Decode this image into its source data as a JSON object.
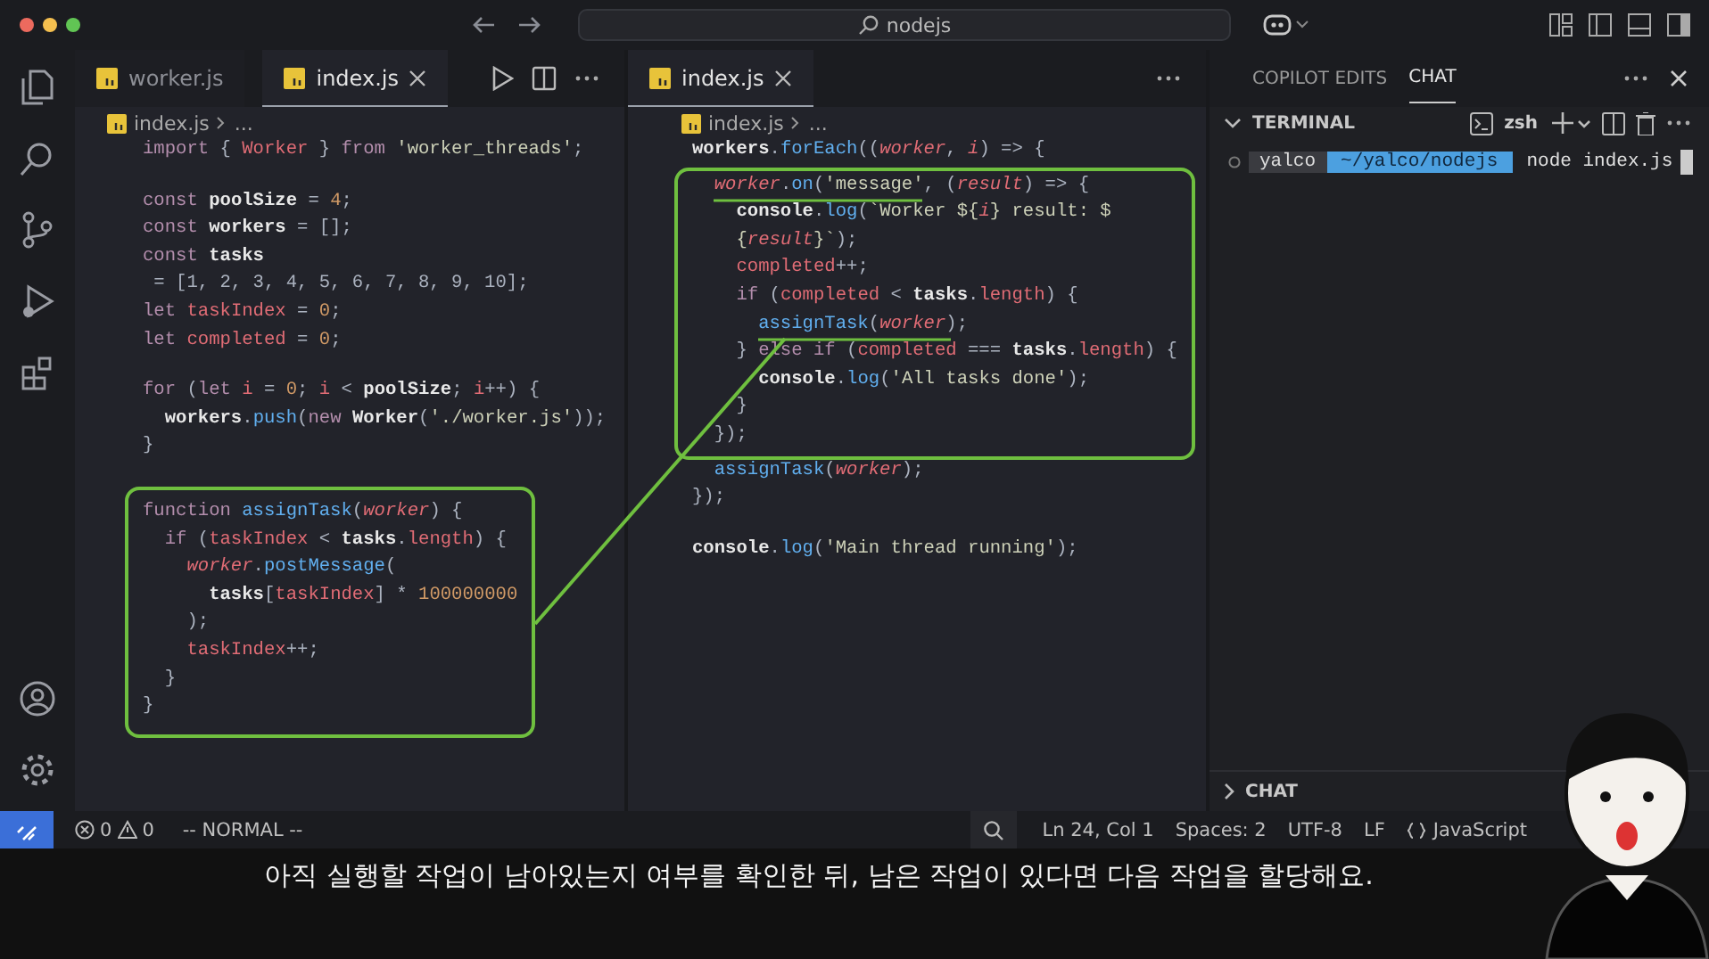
{
  "title_bar": {
    "search": "nodejs"
  },
  "editors": [
    {
      "tabs": [
        {
          "label": "worker.js",
          "selected": false
        },
        {
          "label": "index.js",
          "selected": true
        }
      ],
      "actions": true,
      "breadcrumb": {
        "file": "index.js",
        "rest": "..."
      },
      "paragraphs": [
        [
          {
            "boxed": false,
            "lines": [
              [
                {
                  "kind": "keyword",
                  "text": "import"
                },
                {
                  "kind": "plain",
                  "text": " { "
                },
                {
                  "kind": "variable",
                  "text": "Worker"
                },
                {
                  "kind": "plain",
                  "text": " } "
                },
                {
                  "kind": "keyword",
                  "text": "from"
                },
                {
                  "kind": "string",
                  "text": " 'worker_threads'"
                },
                {
                  "kind": "plain",
                  "text": ";"
                }
              ]
            ]
          }
        ],
        [
          {
            "boxed": false,
            "lines": [
              [
                {
                  "kind": "keyword",
                  "text": "const"
                },
                {
                  "kind": "constant",
                  "text": " poolSize"
                },
                {
                  "kind": "plain",
                  "text": " = "
                },
                {
                  "kind": "number",
                  "text": "4"
                },
                {
                  "kind": "plain",
                  "text": ";"
                }
              ],
              [
                {
                  "kind": "keyword",
                  "text": "const"
                },
                {
                  "kind": "constant",
                  "text": " workers"
                },
                {
                  "kind": "plain",
                  "text": " = [];"
                }
              ],
              [
                {
                  "kind": "keyword",
                  "text": "const"
                },
                {
                  "kind": "constant",
                  "text": " tasks"
                }
              ],
              [
                {
                  "kind": "plain",
                  "text": " = [1, 2, 3, 4, 5, 6, 7, 8, 9, 10];"
                }
              ],
              [
                {
                  "kind": "keyword",
                  "text": "let"
                },
                {
                  "kind": "variable",
                  "text": " taskIndex"
                },
                {
                  "kind": "plain",
                  "text": " = "
                },
                {
                  "kind": "number",
                  "text": "0"
                },
                {
                  "kind": "plain",
                  "text": ";"
                }
              ],
              [
                {
                  "kind": "keyword",
                  "text": "let"
                },
                {
                  "kind": "variable",
                  "text": " completed"
                },
                {
                  "kind": "plain",
                  "text": " = "
                },
                {
                  "kind": "number",
                  "text": "0"
                },
                {
                  "kind": "plain",
                  "text": ";"
                }
              ]
            ]
          }
        ],
        [
          {
            "boxed": false,
            "lines": [
              [
                {
                  "kind": "keyword",
                  "text": "for"
                },
                {
                  "kind": "plain",
                  "text": " ("
                },
                {
                  "kind": "keyword",
                  "text": "let"
                },
                {
                  "kind": "variable",
                  "text": " i"
                },
                {
                  "kind": "plain",
                  "text": " = "
                },
                {
                  "kind": "number",
                  "text": "0"
                },
                {
                  "kind": "plain",
                  "text": "; "
                },
                {
                  "kind": "variable",
                  "text": "i"
                },
                {
                  "kind": "plain",
                  "text": " < "
                },
                {
                  "kind": "constant",
                  "text": "poolSize"
                },
                {
                  "kind": "plain",
                  "text": "; "
                },
                {
                  "kind": "variable",
                  "text": "i"
                },
                {
                  "kind": "plain",
                  "text": "++) {"
                }
              ],
              [
                {
                  "kind": "constant",
                  "text": "  workers"
                },
                {
                  "kind": "plain",
                  "text": "."
                },
                {
                  "kind": "function",
                  "text": "push"
                },
                {
                  "kind": "plain",
                  "text": "("
                },
                {
                  "kind": "keyword",
                  "text": "new"
                },
                {
                  "kind": "constant",
                  "text": " Worker"
                },
                {
                  "kind": "plain",
                  "text": "("
                },
                {
                  "kind": "string",
                  "text": "'./worker.js'"
                },
                {
                  "kind": "plain",
                  "text": "));"
                }
              ],
              [
                {
                  "kind": "plain",
                  "text": "}"
                }
              ]
            ]
          }
        ],
        [
          {
            "boxed": true,
            "lines": [
              [
                {
                  "kind": "keyword",
                  "text": "function"
                },
                {
                  "kind": "function",
                  "text": " assignTask"
                },
                {
                  "kind": "plain",
                  "text": "("
                },
                {
                  "kind": "param",
                  "text": "worker"
                },
                {
                  "kind": "plain",
                  "text": ") {"
                }
              ],
              [
                {
                  "kind": "keyword",
                  "text": "  if"
                },
                {
                  "kind": "plain",
                  "text": " ("
                },
                {
                  "kind": "variable",
                  "text": "taskIndex"
                },
                {
                  "kind": "plain",
                  "text": " < "
                },
                {
                  "kind": "constant",
                  "text": "tasks"
                },
                {
                  "kind": "plain",
                  "text": "."
                },
                {
                  "kind": "variable",
                  "text": "length"
                },
                {
                  "kind": "plain",
                  "text": ") {"
                }
              ],
              [
                {
                  "kind": "param",
                  "text": "    worker"
                },
                {
                  "kind": "plain",
                  "text": "."
                },
                {
                  "kind": "function",
                  "text": "postMessage"
                },
                {
                  "kind": "plain",
                  "text": "("
                }
              ],
              [
                {
                  "kind": "constant",
                  "text": "      tasks"
                },
                {
                  "kind": "plain",
                  "text": "["
                },
                {
                  "kind": "variable",
                  "text": "taskIndex"
                },
                {
                  "kind": "plain",
                  "text": "] * "
                },
                {
                  "kind": "number",
                  "text": "100000000"
                }
              ],
              [
                {
                  "kind": "plain",
                  "text": "    );"
                }
              ],
              [
                {
                  "kind": "variable",
                  "text": "    taskIndex"
                },
                {
                  "kind": "plain",
                  "text": "++;"
                }
              ],
              [
                {
                  "kind": "plain",
                  "text": "  }"
                }
              ],
              [
                {
                  "kind": "plain",
                  "text": "}"
                }
              ]
            ]
          }
        ]
      ]
    },
    {
      "tabs": [
        {
          "label": "index.js",
          "selected": true
        }
      ],
      "actions": false,
      "breadcrumb": {
        "file": "index.js",
        "rest": "..."
      },
      "paragraphs": [
        [
          {
            "boxed": false,
            "lines": [
              [
                {
                  "kind": "constant",
                  "text": "workers"
                },
                {
                  "kind": "plain",
                  "text": "."
                },
                {
                  "kind": "function",
                  "text": "forEach"
                },
                {
                  "kind": "plain",
                  "text": "(("
                },
                {
                  "kind": "param",
                  "text": "worker"
                },
                {
                  "kind": "plain",
                  "text": ", "
                },
                {
                  "kind": "param",
                  "text": "i"
                },
                {
                  "kind": "plain",
                  "text": ") => {"
                }
              ]
            ]
          },
          {
            "boxed": true,
            "lines": [
              [
                {
                  "kind": "param",
                  "text": "  worker"
                },
                {
                  "kind": "plain",
                  "text": "."
                },
                {
                  "kind": "function",
                  "text": "on"
                },
                {
                  "kind": "plain",
                  "text": "("
                },
                {
                  "kind": "string",
                  "text": "'message'"
                },
                {
                  "kind": "plain",
                  "text": ", ("
                },
                {
                  "kind": "param",
                  "text": "result"
                },
                {
                  "kind": "plain",
                  "text": ") => {"
                }
              ],
              [
                {
                  "kind": "constant",
                  "text": "    console"
                },
                {
                  "kind": "plain",
                  "text": "."
                },
                {
                  "kind": "function",
                  "text": "log"
                },
                {
                  "kind": "plain",
                  "text": "("
                },
                {
                  "kind": "string",
                  "text": "`Worker ${"
                },
                {
                  "kind": "param",
                  "text": "i"
                },
                {
                  "kind": "string",
                  "text": "} result: $"
                }
              ],
              [
                {
                  "kind": "string",
                  "text": "    {"
                },
                {
                  "kind": "param",
                  "text": "result"
                },
                {
                  "kind": "string",
                  "text": "}`"
                },
                {
                  "kind": "plain",
                  "text": ");"
                }
              ],
              [
                {
                  "kind": "variable",
                  "text": "    completed"
                },
                {
                  "kind": "plain",
                  "text": "++;"
                }
              ],
              [
                {
                  "kind": "keyword",
                  "text": "    if"
                },
                {
                  "kind": "plain",
                  "text": " ("
                },
                {
                  "kind": "variable",
                  "text": "completed"
                },
                {
                  "kind": "plain",
                  "text": " < "
                },
                {
                  "kind": "constant",
                  "text": "tasks"
                },
                {
                  "kind": "plain",
                  "text": "."
                },
                {
                  "kind": "variable",
                  "text": "length"
                },
                {
                  "kind": "plain",
                  "text": ") {"
                }
              ],
              [
                {
                  "kind": "function",
                  "text": "      assignTask"
                },
                {
                  "kind": "plain",
                  "text": "("
                },
                {
                  "kind": "param",
                  "text": "worker"
                },
                {
                  "kind": "plain",
                  "text": ");"
                }
              ],
              [
                {
                  "kind": "plain",
                  "text": "    } "
                },
                {
                  "kind": "keyword",
                  "text": "else if"
                },
                {
                  "kind": "plain",
                  "text": " ("
                },
                {
                  "kind": "variable",
                  "text": "completed"
                },
                {
                  "kind": "plain",
                  "text": " === "
                },
                {
                  "kind": "constant",
                  "text": "tasks"
                },
                {
                  "kind": "plain",
                  "text": "."
                },
                {
                  "kind": "variable",
                  "text": "length"
                },
                {
                  "kind": "plain",
                  "text": ") {"
                }
              ],
              [
                {
                  "kind": "constant",
                  "text": "      console"
                },
                {
                  "kind": "plain",
                  "text": "."
                },
                {
                  "kind": "function",
                  "text": "log"
                },
                {
                  "kind": "plain",
                  "text": "("
                },
                {
                  "kind": "string",
                  "text": "'All tasks done'"
                },
                {
                  "kind": "plain",
                  "text": ");"
                }
              ],
              [
                {
                  "kind": "plain",
                  "text": "    }"
                }
              ],
              [
                {
                  "kind": "plain",
                  "text": "  });"
                }
              ]
            ]
          },
          {
            "boxed": false,
            "lines": [
              [
                {
                  "kind": "function",
                  "text": "  assignTask"
                },
                {
                  "kind": "plain",
                  "text": "("
                },
                {
                  "kind": "param",
                  "text": "worker"
                },
                {
                  "kind": "plain",
                  "text": ");"
                }
              ],
              [
                {
                  "kind": "plain",
                  "text": "});"
                }
              ]
            ]
          }
        ],
        [
          {
            "boxed": false,
            "lines": [
              [
                {
                  "kind": "constant",
                  "text": "console"
                },
                {
                  "kind": "plain",
                  "text": "."
                },
                {
                  "kind": "function",
                  "text": "log"
                },
                {
                  "kind": "plain",
                  "text": "("
                },
                {
                  "kind": "string",
                  "text": "'Main thread running'"
                },
                {
                  "kind": "plain",
                  "text": ");"
                }
              ]
            ]
          }
        ]
      ]
    }
  ],
  "panel": {
    "tabs": [
      {
        "label": "COPILOT EDITS",
        "selected": false
      },
      {
        "label": "CHAT",
        "selected": true
      }
    ],
    "terminal": {
      "title": "TERMINAL",
      "expanded": true,
      "shell": "zsh",
      "user": "yalco",
      "path": "~/yalco/nodejs",
      "command": "node index.js"
    },
    "chat_section": {
      "title": "CHAT",
      "expanded": false
    }
  },
  "status_bar": {
    "errors": "0",
    "warnings": "0",
    "mode": "-- NORMAL --",
    "right": [
      "Ln 24, Col 1",
      "Spaces: 2",
      "UTF-8",
      "LF"
    ],
    "language": "JavaScript"
  },
  "subtitle": "아직 실행할 작업이 남아있는지 여부를 확인한 뒤, 남은 작업이 있다면 다음 작업을 할당해요."
}
